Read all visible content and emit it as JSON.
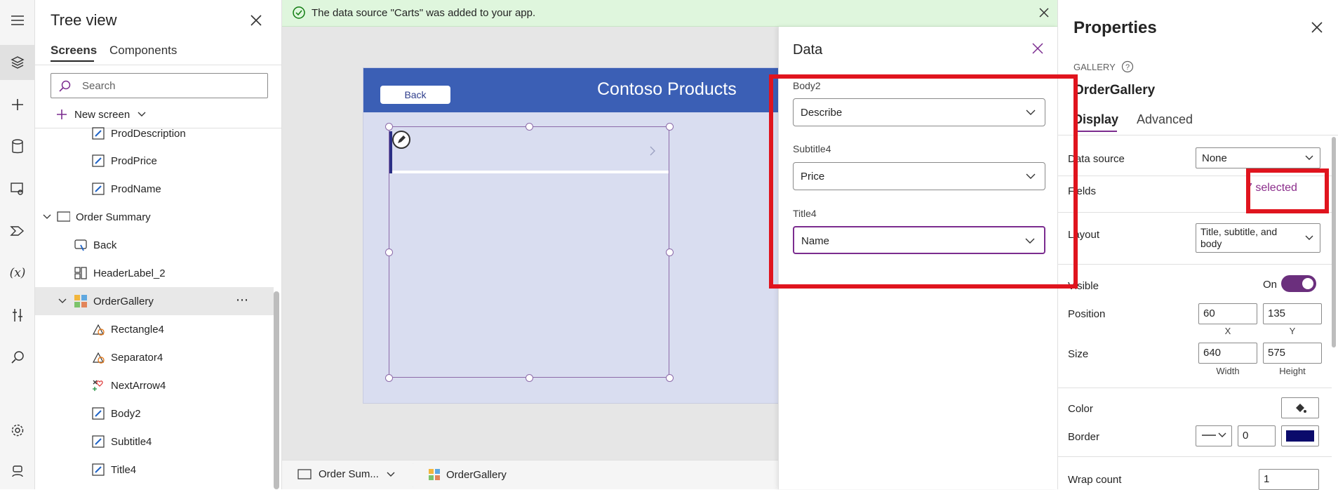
{
  "notification": {
    "text": "The data source \"Carts\" was added to your app.",
    "color": "#dff6dd"
  },
  "tree": {
    "title": "Tree view",
    "tabs": [
      "Screens",
      "Components"
    ],
    "search_placeholder": "Search",
    "new_screen_label": "New screen",
    "items": [
      {
        "label": "ProdDescription",
        "icon": "label-edit-icon",
        "level": 2
      },
      {
        "label": "ProdPrice",
        "icon": "label-edit-icon",
        "level": 2
      },
      {
        "label": "ProdName",
        "icon": "label-edit-icon",
        "level": 2
      },
      {
        "label": "Order Summary",
        "icon": "screen-icon",
        "level": 0
      },
      {
        "label": "Back",
        "icon": "button-icon",
        "level": 1
      },
      {
        "label": "HeaderLabel_2",
        "icon": "container-icon",
        "level": 1
      },
      {
        "label": "OrderGallery",
        "icon": "gallery-icon",
        "level": 1
      },
      {
        "label": "Rectangle4",
        "icon": "shape-icon",
        "level": 2
      },
      {
        "label": "Separator4",
        "icon": "shape-icon",
        "level": 2
      },
      {
        "label": "NextArrow4",
        "icon": "icon-icon",
        "level": 2
      },
      {
        "label": "Body2",
        "icon": "label-edit-icon",
        "level": 2
      },
      {
        "label": "Subtitle4",
        "icon": "label-edit-icon",
        "level": 2
      },
      {
        "label": "Title4",
        "icon": "label-edit-icon",
        "level": 2
      }
    ]
  },
  "canvas": {
    "back_label": "Back",
    "app_title": "Contoso Products",
    "header_color": "#3b5fb5"
  },
  "breadcrumb": {
    "screen": "Order Sum...",
    "control": "OrderGallery"
  },
  "data_panel": {
    "title": "Data",
    "fields": [
      {
        "label": "Body2",
        "value": "Describe"
      },
      {
        "label": "Subtitle4",
        "value": "Price"
      },
      {
        "label": "Title4",
        "value": "Name"
      }
    ]
  },
  "properties": {
    "title": "Properties",
    "control_type": "GALLERY",
    "control_name": "OrderGallery",
    "tabs": [
      "Display",
      "Advanced"
    ],
    "data_source_label": "Data source",
    "data_source_value": "None",
    "fields_label": "Fields",
    "fields_value": "7 selected",
    "layout_label": "Layout",
    "layout_value": "Title, subtitle, and body",
    "visible_label": "Visible",
    "visible_value": "On",
    "position_label": "Position",
    "position_x": "60",
    "position_y": "135",
    "x_label": "X",
    "y_label": "Y",
    "size_label": "Size",
    "size_width": "640",
    "size_height": "575",
    "width_label": "Width",
    "height_label": "Height",
    "color_label": "Color",
    "border_label": "Border",
    "border_width": "0",
    "border_color": "#0a0a6b",
    "wrap_label": "Wrap count",
    "wrap_value": "1"
  },
  "highlight_color": "#e0141e"
}
